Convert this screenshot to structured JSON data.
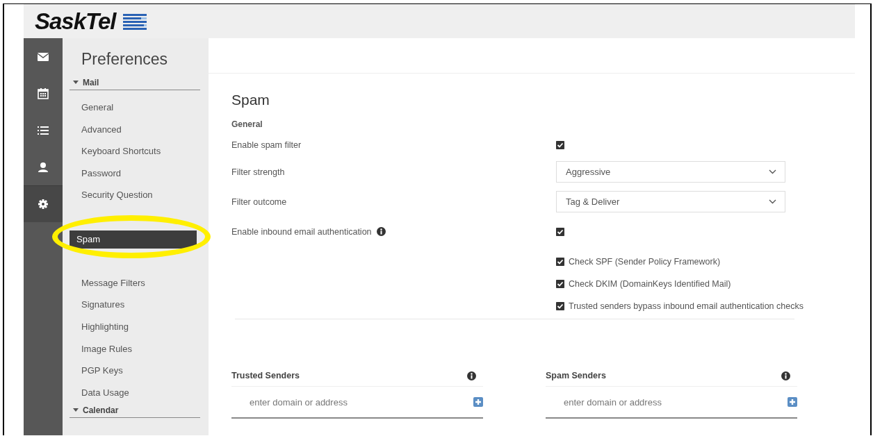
{
  "logo": {
    "text": "SaskTel"
  },
  "rail": [
    {
      "kind": "mail",
      "selected": false
    },
    {
      "kind": "calendar",
      "selected": false
    },
    {
      "kind": "list",
      "selected": false
    },
    {
      "kind": "contact",
      "selected": false
    },
    {
      "kind": "settings",
      "selected": true
    }
  ],
  "sidebar": {
    "title": "Preferences",
    "sections": [
      {
        "label": "Mail",
        "expanded": true,
        "items": [
          {
            "label": "General",
            "selected": false
          },
          {
            "label": "Advanced",
            "selected": false
          },
          {
            "label": "Keyboard Shortcuts",
            "selected": false
          },
          {
            "label": "Password",
            "selected": false
          },
          {
            "label": "Security Question",
            "selected": false
          },
          {
            "label": "Spam",
            "selected": true
          },
          {
            "label": "Message Filters",
            "selected": false
          },
          {
            "label": "Signatures",
            "selected": false
          },
          {
            "label": "Highlighting",
            "selected": false
          },
          {
            "label": "Image Rules",
            "selected": false
          },
          {
            "label": "PGP Keys",
            "selected": false
          },
          {
            "label": "Data Usage",
            "selected": false
          }
        ]
      },
      {
        "label": "Calendar",
        "expanded": true
      }
    ]
  },
  "annotation": {
    "kind": "ellipse"
  },
  "page": {
    "title": "Spam",
    "section": "General",
    "settings": [
      {
        "kind": "checkbox",
        "label": "Enable spam filter",
        "checked": true
      },
      {
        "kind": "select",
        "label": "Filter strength",
        "value": "Aggressive"
      },
      {
        "kind": "select",
        "label": "Filter outcome",
        "value": "Tag & Deliver"
      },
      {
        "kind": "checkbox",
        "label": "Enable inbound email authentication",
        "info": true,
        "checked": true,
        "options": [
          {
            "label": "Check SPF (Sender Policy Framework)",
            "checked": true
          },
          {
            "label": "Check DKIM (DomainKeys Identified Mail)",
            "checked": true
          },
          {
            "label": "Trusted senders bypass inbound email authentication checks",
            "checked": true
          }
        ]
      }
    ],
    "lists": [
      {
        "title": "Trusted Senders",
        "placeholder": "enter domain or address"
      },
      {
        "title": "Spam Senders",
        "placeholder": "enter domain or address"
      }
    ]
  }
}
